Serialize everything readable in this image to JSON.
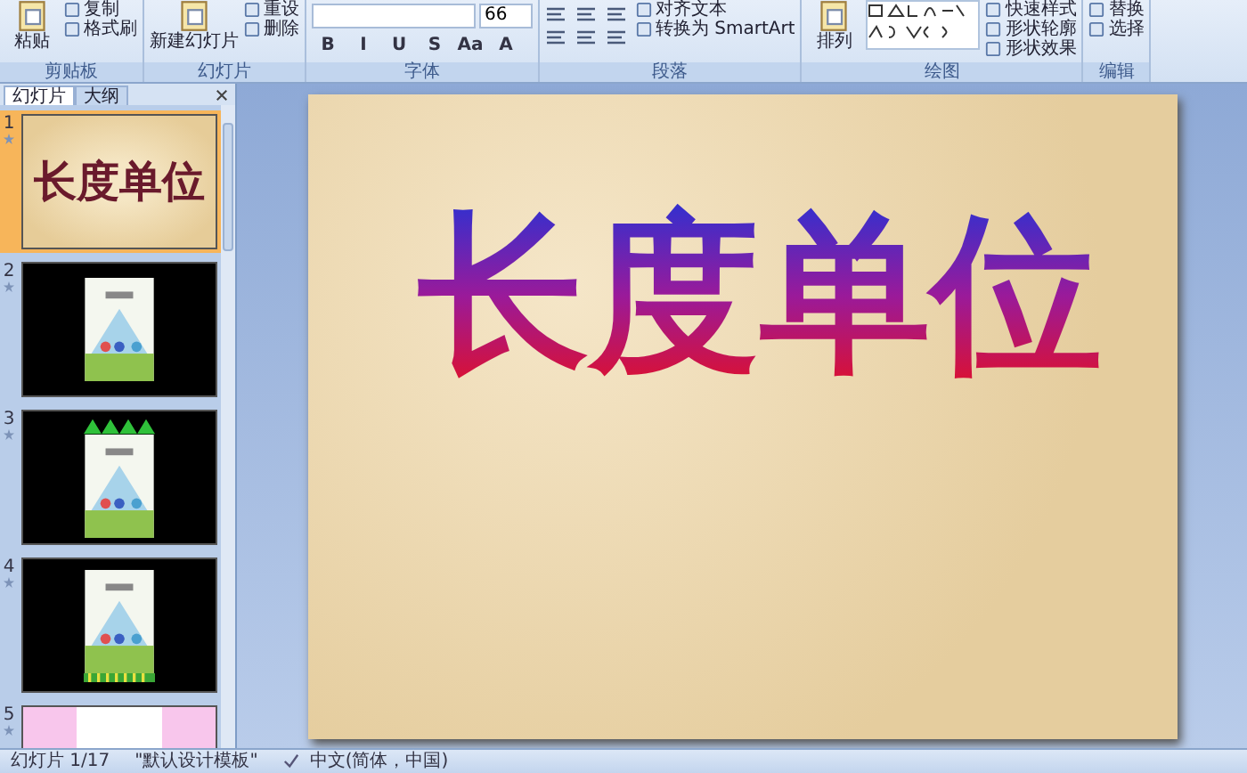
{
  "ribbon": {
    "groups": [
      {
        "label": "剪贴板",
        "large": {
          "label": "粘贴"
        },
        "small": [
          {
            "label": "复制"
          },
          {
            "label": "格式刷"
          }
        ]
      },
      {
        "label": "幻灯片",
        "large": {
          "label": "新建幻灯片"
        },
        "small": [
          {
            "label": "重设"
          },
          {
            "label": "删除"
          }
        ]
      },
      {
        "label": "字体",
        "font_size": "66",
        "format_buttons": [
          "B",
          "I",
          "U",
          "S",
          "Aa",
          "A"
        ]
      },
      {
        "label": "段落",
        "small": [
          {
            "label": "对齐文本"
          },
          {
            "label": "转换为 SmartArt"
          }
        ]
      },
      {
        "label": "绘图",
        "large": {
          "label": "排列"
        },
        "small": [
          {
            "label": "快速样式"
          },
          {
            "label": "形状轮廓"
          },
          {
            "label": "形状效果"
          }
        ]
      },
      {
        "label": "编辑",
        "small": [
          {
            "label": "替换"
          },
          {
            "label": "选择"
          }
        ]
      }
    ]
  },
  "panel": {
    "tabs": [
      {
        "label": "幻灯片",
        "selected": true
      },
      {
        "label": "大纲",
        "selected": false
      }
    ],
    "thumbnails": [
      {
        "number": "1",
        "kind": "title",
        "title": "长度单位",
        "selected": true
      },
      {
        "number": "2",
        "kind": "cover",
        "selected": false
      },
      {
        "number": "3",
        "kind": "cover-triangles",
        "selected": false
      },
      {
        "number": "4",
        "kind": "cover-stripes",
        "selected": false
      },
      {
        "number": "5",
        "kind": "pink",
        "selected": false
      }
    ]
  },
  "slide": {
    "title": "长度单位"
  },
  "status_bar": {
    "slide_counter": "幻灯片 1/17",
    "theme": "\"默认设计模板\"",
    "language": "中文(简体，中国)"
  }
}
